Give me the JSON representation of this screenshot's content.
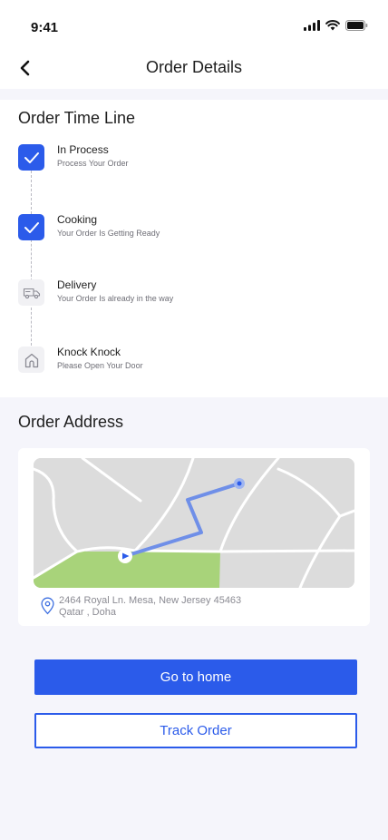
{
  "status_bar": {
    "time": "9:41",
    "icons": [
      "cellular-signal-icon",
      "wifi-icon",
      "battery-icon"
    ]
  },
  "header": {
    "back_icon": "chevron-left-icon",
    "title": "Order Details"
  },
  "timeline": {
    "title": "Order Time Line",
    "items": [
      {
        "title": "In Process",
        "subtitle": "Process Your Order",
        "status": "done",
        "icon": "check-icon"
      },
      {
        "title": "Cooking",
        "subtitle": "Your Order Is Getting Ready",
        "status": "done",
        "icon": "check-icon"
      },
      {
        "title": "Delivery",
        "subtitle": "Your Order Is already in the way",
        "status": "pending",
        "icon": "delivery-truck-icon"
      },
      {
        "title": "Knock Knock",
        "subtitle": "Please Open Your Door",
        "status": "pending",
        "icon": "home-icon"
      }
    ]
  },
  "address": {
    "title": "Order Address",
    "line1": "2464 Royal Ln. Mesa, New Jersey 45463",
    "line2": "Qatar , Doha",
    "pin_icon": "location-pin-icon"
  },
  "buttons": {
    "home_label": "Go to home",
    "track_label": "Track Order"
  },
  "colors": {
    "primary": "#2B5BEA",
    "page_background": "#F5F5FB",
    "map_background": "#DCDCDC",
    "map_park": "#A8D37A",
    "route": "#6F8FE8"
  }
}
